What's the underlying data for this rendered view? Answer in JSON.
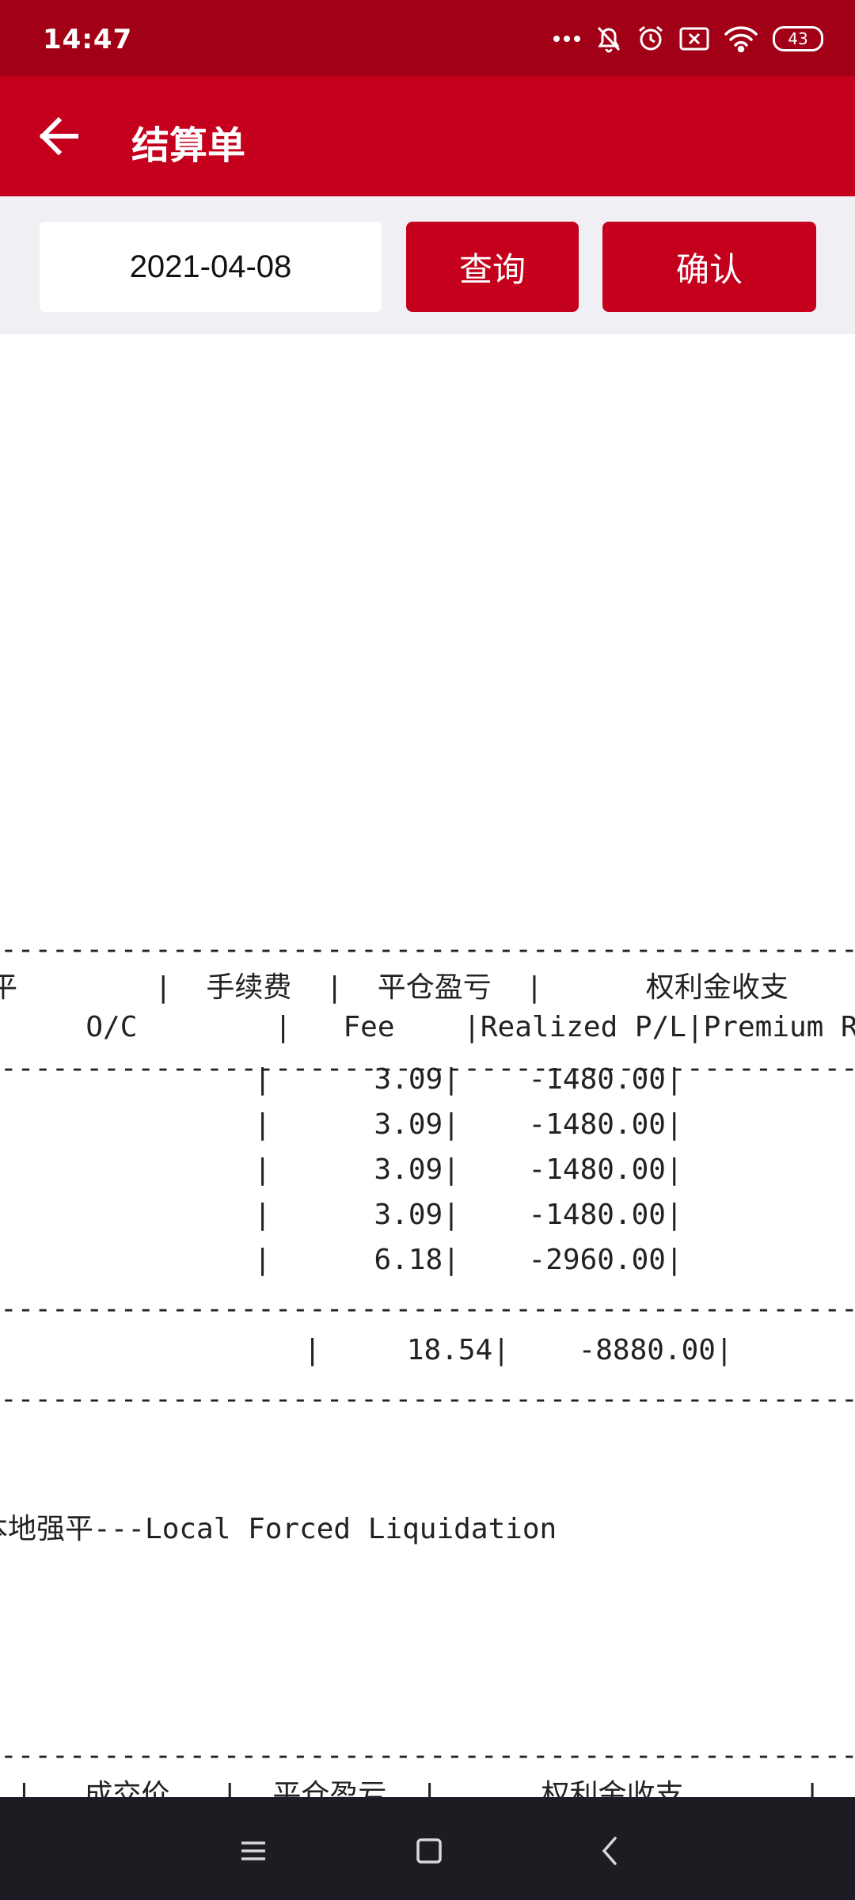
{
  "status_bar": {
    "time": "14:47",
    "battery": "43",
    "icons": [
      "more-dots-icon",
      "bell-muted-icon",
      "alarm-icon",
      "close-box-icon",
      "wifi-icon",
      "battery-icon"
    ]
  },
  "app_bar": {
    "title": "结算单",
    "back_icon": "back-arrow-icon"
  },
  "toolbar": {
    "date_value": "2021-04-08",
    "query_label": "查询",
    "confirm_label": "确认"
  },
  "report": {
    "divider": "------------------------------------------------------------------------------------------------",
    "header_cn": "平        |  手续费  |  平仓盈亏  |      权利金收支       |",
    "header_en": "     O/C        |   Fee    |Realized P/L|Premium Re",
    "rows": [
      "             |      3.09|    -1480.00|",
      "             |      3.09|    -1480.00|",
      "             |      3.09|    -1480.00|",
      "             |      3.09|    -1480.00|",
      "             |      6.18|    -2960.00|"
    ],
    "total_row": "                |     18.54|    -8880.00|",
    "note": "本地强平---Local Forced Liquidation",
    "header2_cn": " |   成交价   |  平仓盈亏  |      权利金收支       |  成交"
  },
  "nav_bar": {
    "icons": [
      "menu-icon",
      "home-icon",
      "back-icon"
    ]
  },
  "colors": {
    "status_bar": "#a20016",
    "app_bar": "#c5001c",
    "button": "#c5001c",
    "toolbar_bg": "#efeff4",
    "nav_bar": "#1c1c22"
  }
}
